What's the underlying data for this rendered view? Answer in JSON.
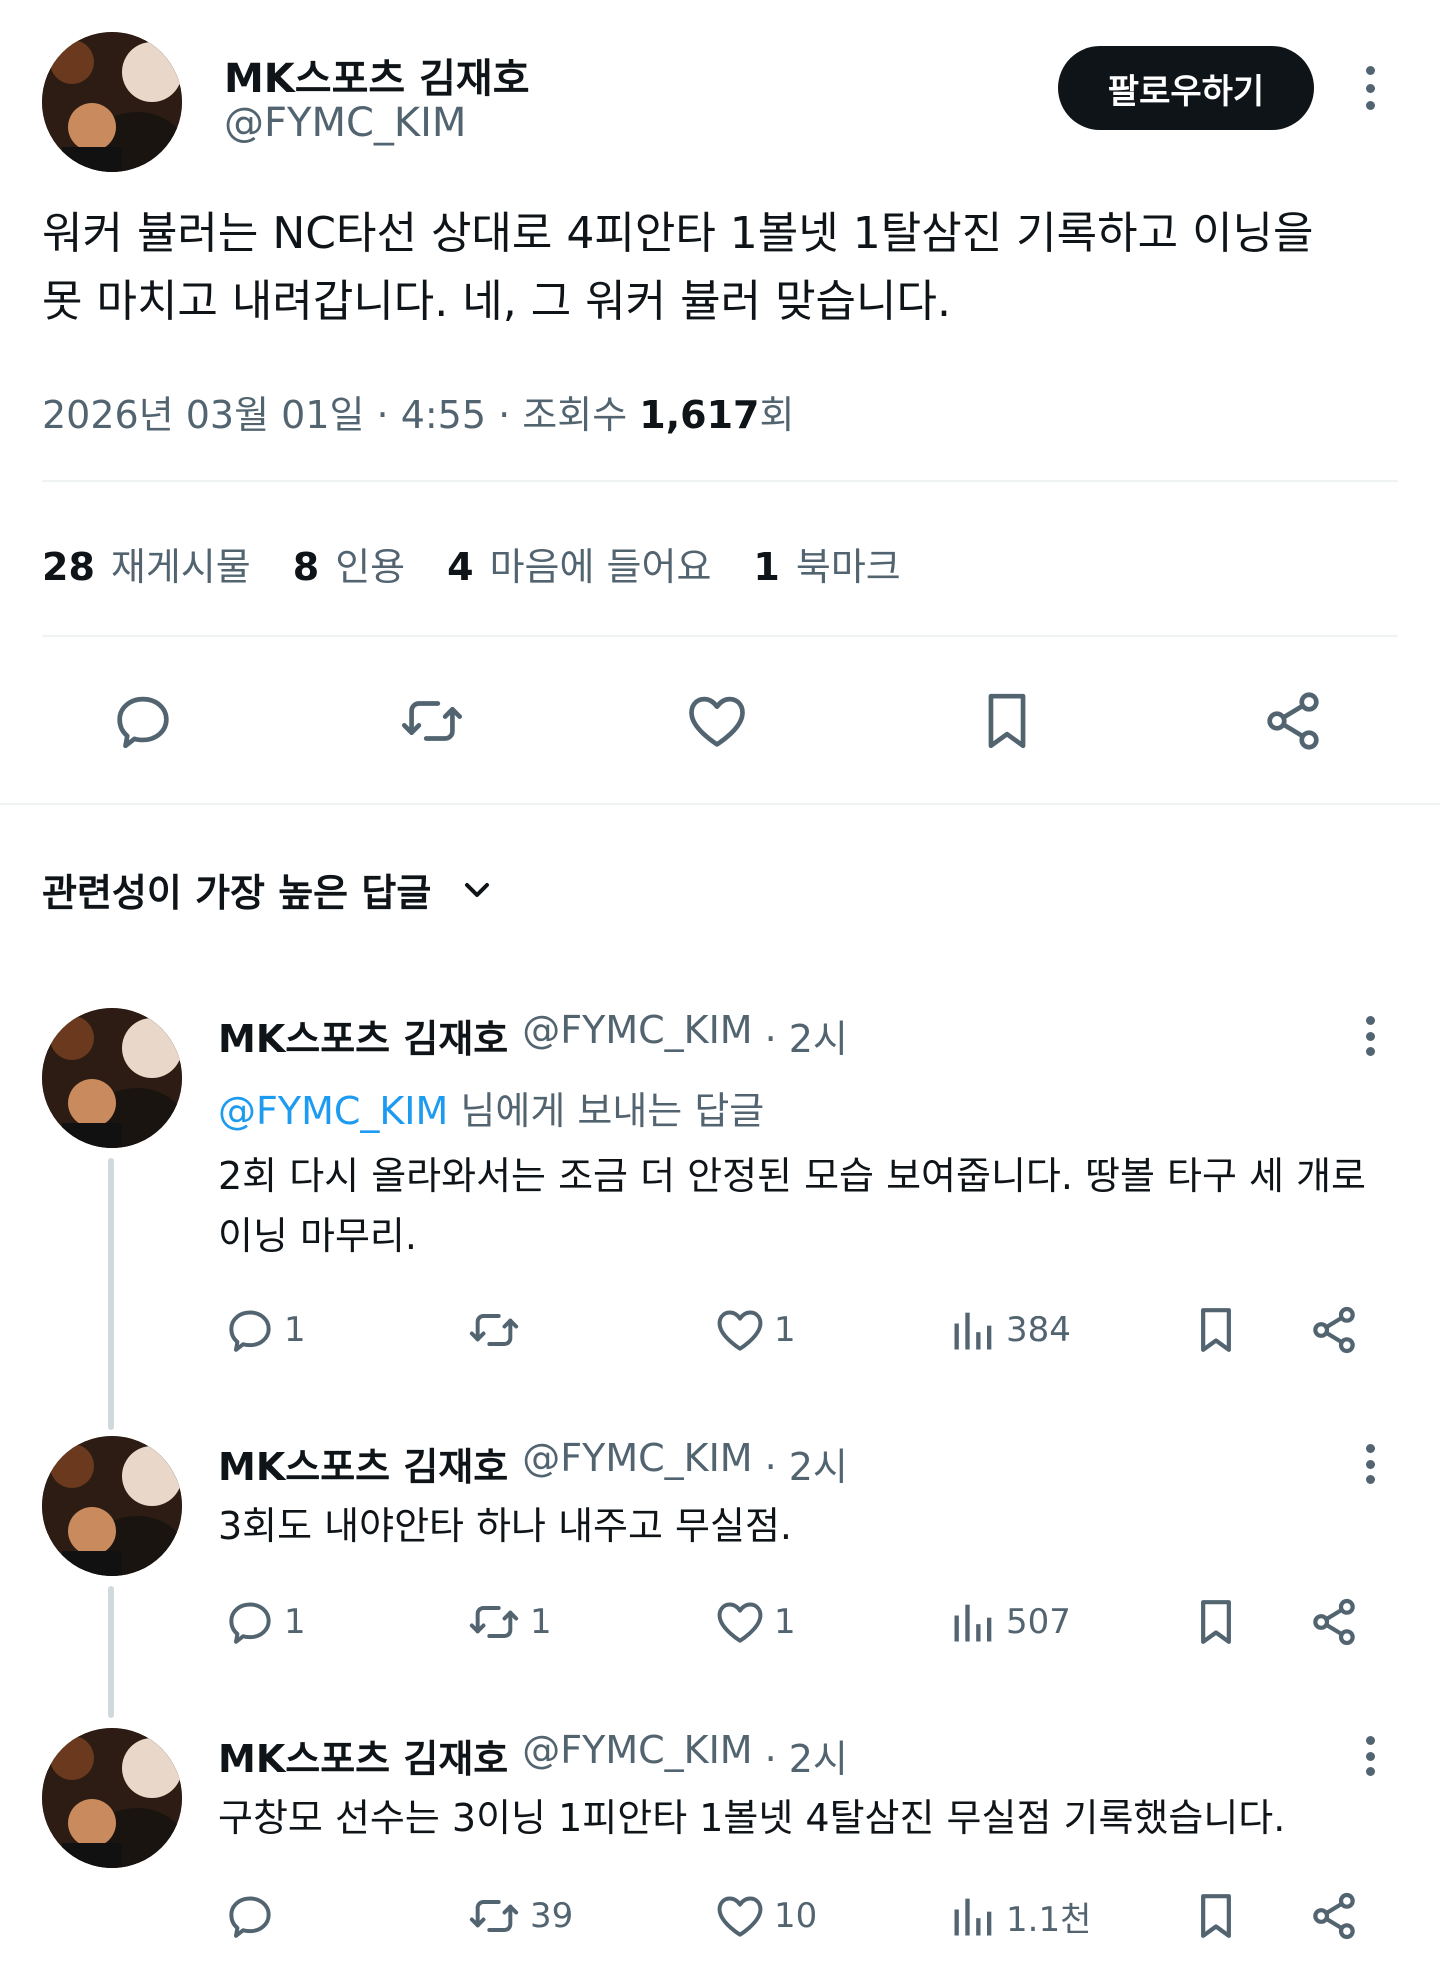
{
  "main_tweet": {
    "name": "MK스포츠 김재호",
    "handle": "@FYMC_KIM",
    "follow_label": "팔로우하기",
    "text_line1": "워커 뷸러는 NC타선 상대로 4피안타 1볼넷 1탈삼진 기록하고 이닝을",
    "text_line2": "못 마치고 내려갑니다. 네, 그 워커 뷸러 맞습니다.",
    "date": "2026년 03월 01일",
    "time": "4:55",
    "views_label": "조회수",
    "views_count": "1,617",
    "views_unit": "회",
    "stats": {
      "retweets_count": "28",
      "retweets_label": "재게시물",
      "quotes_count": "8",
      "quotes_label": "인용",
      "likes_count": "4",
      "likes_label": "마음에 들어요",
      "bookmarks_count": "1",
      "bookmarks_label": "북마크"
    }
  },
  "replies_header": {
    "sort_label": "관련성이 가장 높은 답글"
  },
  "replies": [
    {
      "name": "MK스포츠 김재호",
      "handle": "@FYMC_KIM",
      "time": "· 2시",
      "reply_to_mention": "@FYMC_KIM",
      "reply_to_suffix": "님에게 보내는 답글",
      "text_line1": "2회 다시 올라와서는 조금 더 안정된 모습 보여줍니다. 땅볼 타구 세 개로",
      "text_line2": "이닝 마무리.",
      "replies_count": "1",
      "retweets_count": "",
      "likes_count": "1",
      "views_count": "384"
    },
    {
      "name": "MK스포츠 김재호",
      "handle": "@FYMC_KIM",
      "time": "· 2시",
      "text_line1": "3회도 내야안타 하나 내주고 무실점.",
      "replies_count": "1",
      "retweets_count": "1",
      "likes_count": "1",
      "views_count": "507"
    },
    {
      "name": "MK스포츠 김재호",
      "handle": "@FYMC_KIM",
      "time": "· 2시",
      "text_line1": "구창모 선수는 3이닝 1피안타 1볼넷 4탈삼진 무실점 기록했습니다.",
      "replies_count": "",
      "retweets_count": "39",
      "likes_count": "10",
      "views_count": "1.1천"
    }
  ],
  "colors": {
    "text": "#0f1419",
    "secondary": "#536471",
    "link": "#1d9bf0",
    "divider": "#eff3f4"
  }
}
